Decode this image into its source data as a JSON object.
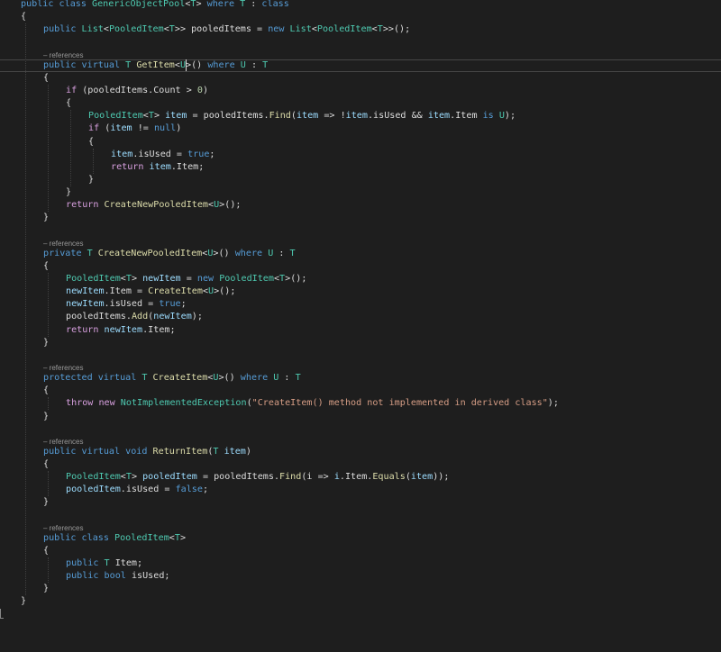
{
  "colors": {
    "background": "#1e1e1e",
    "keyword": "#569cd6",
    "control": "#d8a0df",
    "type": "#4ec9b0",
    "method": "#dcdcaa",
    "variable": "#9cdcfe",
    "string": "#d69d85",
    "number": "#b5cea8",
    "plain": "#dcdcdc",
    "lens": "#999999"
  },
  "editor": {
    "lines": [
      {
        "indent": 1,
        "tokens": [
          [
            "public class ",
            "k"
          ],
          [
            "GenericObjectPool",
            "t"
          ],
          [
            "<",
            "p"
          ],
          [
            "T",
            "t"
          ],
          [
            "> ",
            "p"
          ],
          [
            "where ",
            "k"
          ],
          [
            "T",
            "t"
          ],
          [
            " : ",
            "p"
          ],
          [
            "class",
            "k"
          ]
        ]
      },
      {
        "indent": 1,
        "tokens": [
          [
            "{",
            "p"
          ]
        ]
      },
      {
        "indent": 2,
        "tokens": [
          [
            "public ",
            "k"
          ],
          [
            "List",
            "t"
          ],
          [
            "<",
            "p"
          ],
          [
            "PooledItem",
            "t"
          ],
          [
            "<",
            "p"
          ],
          [
            "T",
            "t"
          ],
          [
            ">> pooledItems = ",
            "p"
          ],
          [
            "new ",
            "k"
          ],
          [
            "List",
            "t"
          ],
          [
            "<",
            "p"
          ],
          [
            "PooledItem",
            "t"
          ],
          [
            "<",
            "p"
          ],
          [
            "T",
            "t"
          ],
          [
            ">>();",
            "p"
          ]
        ]
      },
      {
        "indent": 0,
        "tokens": []
      },
      {
        "lens": "– references",
        "indent": 2,
        "tokens": [
          [
            "public virtual ",
            "k"
          ],
          [
            "T ",
            "t"
          ],
          [
            "GetItem",
            "m"
          ],
          [
            "<",
            "p"
          ],
          [
            "U",
            "t"
          ],
          [
            ">() ",
            "p"
          ],
          [
            "where ",
            "k"
          ],
          [
            "U",
            "t"
          ],
          [
            " : ",
            "p"
          ],
          [
            "T",
            "t"
          ]
        ]
      },
      {
        "indent": 2,
        "tokens": [
          [
            "{",
            "p"
          ]
        ]
      },
      {
        "indent": 3,
        "tokens": [
          [
            "if ",
            "c"
          ],
          [
            "(pooledItems.Count > ",
            "p"
          ],
          [
            "0",
            "n"
          ],
          [
            ")",
            "p"
          ]
        ]
      },
      {
        "indent": 3,
        "tokens": [
          [
            "{",
            "p"
          ]
        ]
      },
      {
        "indent": 4,
        "tokens": [
          [
            "PooledItem",
            "t"
          ],
          [
            "<",
            "p"
          ],
          [
            "T",
            "t"
          ],
          [
            "> ",
            "p"
          ],
          [
            "item",
            "v"
          ],
          [
            " = pooledItems.",
            "p"
          ],
          [
            "Find",
            "m"
          ],
          [
            "(",
            "p"
          ],
          [
            "item",
            "v"
          ],
          [
            " => !",
            "p"
          ],
          [
            "item",
            "v"
          ],
          [
            ".isUsed && ",
            "p"
          ],
          [
            "item",
            "v"
          ],
          [
            ".Item ",
            "p"
          ],
          [
            "is ",
            "k"
          ],
          [
            "U",
            "t"
          ],
          [
            ");",
            "p"
          ]
        ]
      },
      {
        "indent": 4,
        "tokens": [
          [
            "if ",
            "c"
          ],
          [
            "(",
            "p"
          ],
          [
            "item",
            "v"
          ],
          [
            " != ",
            "p"
          ],
          [
            "null",
            "k"
          ],
          [
            ")",
            "p"
          ]
        ]
      },
      {
        "indent": 4,
        "tokens": [
          [
            "{",
            "p"
          ]
        ]
      },
      {
        "indent": 5,
        "tokens": [
          [
            "item",
            "v"
          ],
          [
            ".isUsed = ",
            "p"
          ],
          [
            "true",
            "k"
          ],
          [
            ";",
            "p"
          ]
        ]
      },
      {
        "indent": 5,
        "tokens": [
          [
            "return ",
            "c"
          ],
          [
            "item",
            "v"
          ],
          [
            ".Item;",
            "p"
          ]
        ]
      },
      {
        "indent": 4,
        "tokens": [
          [
            "}",
            "p"
          ]
        ]
      },
      {
        "indent": 3,
        "tokens": [
          [
            "}",
            "p"
          ]
        ]
      },
      {
        "indent": 3,
        "tokens": [
          [
            "return ",
            "c"
          ],
          [
            "CreateNewPooledItem",
            "m"
          ],
          [
            "<",
            "p"
          ],
          [
            "U",
            "t"
          ],
          [
            ">();",
            "p"
          ]
        ]
      },
      {
        "indent": 2,
        "tokens": [
          [
            "}",
            "p"
          ]
        ]
      },
      {
        "indent": 0,
        "tokens": []
      },
      {
        "lens": "– references",
        "indent": 2,
        "tokens": [
          [
            "private ",
            "k"
          ],
          [
            "T ",
            "t"
          ],
          [
            "CreateNewPooledItem",
            "m"
          ],
          [
            "<",
            "p"
          ],
          [
            "U",
            "t"
          ],
          [
            ">() ",
            "p"
          ],
          [
            "where ",
            "k"
          ],
          [
            "U",
            "t"
          ],
          [
            " : ",
            "p"
          ],
          [
            "T",
            "t"
          ]
        ]
      },
      {
        "indent": 2,
        "tokens": [
          [
            "{",
            "p"
          ]
        ]
      },
      {
        "indent": 3,
        "tokens": [
          [
            "PooledItem",
            "t"
          ],
          [
            "<",
            "p"
          ],
          [
            "T",
            "t"
          ],
          [
            "> ",
            "p"
          ],
          [
            "newItem",
            "v"
          ],
          [
            " = ",
            "p"
          ],
          [
            "new ",
            "k"
          ],
          [
            "PooledItem",
            "t"
          ],
          [
            "<",
            "p"
          ],
          [
            "T",
            "t"
          ],
          [
            ">();",
            "p"
          ]
        ]
      },
      {
        "indent": 3,
        "tokens": [
          [
            "newItem",
            "v"
          ],
          [
            ".Item = ",
            "p"
          ],
          [
            "CreateItem",
            "m"
          ],
          [
            "<",
            "p"
          ],
          [
            "U",
            "t"
          ],
          [
            ">();",
            "p"
          ]
        ]
      },
      {
        "indent": 3,
        "tokens": [
          [
            "newItem",
            "v"
          ],
          [
            ".isUsed = ",
            "p"
          ],
          [
            "true",
            "k"
          ],
          [
            ";",
            "p"
          ]
        ]
      },
      {
        "indent": 3,
        "tokens": [
          [
            "pooledItems.",
            "p"
          ],
          [
            "Add",
            "m"
          ],
          [
            "(",
            "p"
          ],
          [
            "newItem",
            "v"
          ],
          [
            ");",
            "p"
          ]
        ]
      },
      {
        "indent": 3,
        "tokens": [
          [
            "return ",
            "c"
          ],
          [
            "newItem",
            "v"
          ],
          [
            ".Item;",
            "p"
          ]
        ]
      },
      {
        "indent": 2,
        "tokens": [
          [
            "}",
            "p"
          ]
        ]
      },
      {
        "indent": 0,
        "tokens": []
      },
      {
        "lens": "– references",
        "indent": 2,
        "tokens": [
          [
            "protected virtual ",
            "k"
          ],
          [
            "T ",
            "t"
          ],
          [
            "CreateItem",
            "m"
          ],
          [
            "<",
            "p"
          ],
          [
            "U",
            "t"
          ],
          [
            ">() ",
            "p"
          ],
          [
            "where ",
            "k"
          ],
          [
            "U",
            "t"
          ],
          [
            " : ",
            "p"
          ],
          [
            "T",
            "t"
          ]
        ]
      },
      {
        "indent": 2,
        "tokens": [
          [
            "{",
            "p"
          ]
        ]
      },
      {
        "indent": 3,
        "tokens": [
          [
            "throw new ",
            "c"
          ],
          [
            "NotImplementedException",
            "t"
          ],
          [
            "(",
            "p"
          ],
          [
            "\"CreateItem() method not implemented in derived class\"",
            "s"
          ],
          [
            ");",
            "p"
          ]
        ]
      },
      {
        "indent": 2,
        "tokens": [
          [
            "}",
            "p"
          ]
        ]
      },
      {
        "indent": 0,
        "tokens": []
      },
      {
        "lens": "– references",
        "indent": 2,
        "tokens": [
          [
            "public virtual void ",
            "k"
          ],
          [
            "ReturnItem",
            "m"
          ],
          [
            "(",
            "p"
          ],
          [
            "T ",
            "t"
          ],
          [
            "item",
            "v"
          ],
          [
            ")",
            "p"
          ]
        ]
      },
      {
        "indent": 2,
        "tokens": [
          [
            "{",
            "p"
          ]
        ]
      },
      {
        "indent": 3,
        "tokens": [
          [
            "PooledItem",
            "t"
          ],
          [
            "<",
            "p"
          ],
          [
            "T",
            "t"
          ],
          [
            "> ",
            "p"
          ],
          [
            "pooledItem",
            "v"
          ],
          [
            " = pooledItems.",
            "p"
          ],
          [
            "Find",
            "m"
          ],
          [
            "(i => ",
            "p"
          ],
          [
            "i",
            "v"
          ],
          [
            ".Item.",
            "p"
          ],
          [
            "Equals",
            "m"
          ],
          [
            "(",
            "p"
          ],
          [
            "item",
            "v"
          ],
          [
            "));",
            "p"
          ]
        ]
      },
      {
        "indent": 3,
        "tokens": [
          [
            "pooledItem",
            "v"
          ],
          [
            ".isUsed = ",
            "p"
          ],
          [
            "false",
            "k"
          ],
          [
            ";",
            "p"
          ]
        ]
      },
      {
        "indent": 2,
        "tokens": [
          [
            "}",
            "p"
          ]
        ]
      },
      {
        "indent": 0,
        "tokens": []
      },
      {
        "lens": "– references",
        "indent": 2,
        "tokens": [
          [
            "public class ",
            "k"
          ],
          [
            "PooledItem",
            "t"
          ],
          [
            "<",
            "p"
          ],
          [
            "T",
            "t"
          ],
          [
            ">",
            "p"
          ]
        ]
      },
      {
        "indent": 2,
        "tokens": [
          [
            "{",
            "p"
          ]
        ]
      },
      {
        "indent": 3,
        "tokens": [
          [
            "public ",
            "k"
          ],
          [
            "T ",
            "t"
          ],
          [
            "Item;",
            "p"
          ]
        ]
      },
      {
        "indent": 3,
        "tokens": [
          [
            "public bool ",
            "k"
          ],
          [
            "isUsed;",
            "p"
          ]
        ]
      },
      {
        "indent": 2,
        "tokens": [
          [
            "}",
            "p"
          ]
        ]
      },
      {
        "indent": 1,
        "tokens": [
          [
            "}",
            "p"
          ]
        ]
      }
    ]
  }
}
